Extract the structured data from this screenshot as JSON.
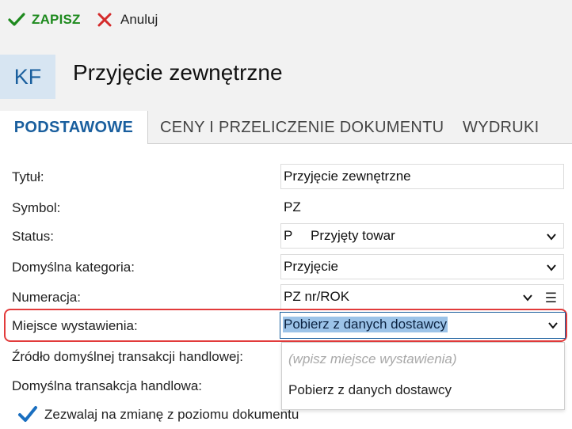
{
  "toolbar": {
    "save_label": "ZAPISZ",
    "cancel_label": "Anuluj"
  },
  "header": {
    "badge": "KF",
    "title": "Przyjęcie zewnętrzne"
  },
  "tabs": [
    {
      "label": "PODSTAWOWE",
      "active": true
    },
    {
      "label": "CENY I PRZELICZENIE DOKUMENTU",
      "active": false
    },
    {
      "label": "WYDRUKI",
      "active": false
    }
  ],
  "form": {
    "tytul": {
      "label": "Tytuł:",
      "value": "Przyjęcie zewnętrzne"
    },
    "symbol": {
      "label": "Symbol:",
      "value": "PZ"
    },
    "status": {
      "label": "Status:",
      "code": "P",
      "value": "Przyjęty towar"
    },
    "kategoria": {
      "label": "Domyślna kategoria:",
      "value": "Przyjęcie"
    },
    "numeracja": {
      "label": "Numeracja:",
      "value": "PZ nr/ROK"
    },
    "miejsce": {
      "label": "Miejsce wystawienia:",
      "value": "Pobierz z danych dostawcy"
    },
    "zrodlo": {
      "label": "Źródło domyślnej transakcji handlowej:"
    },
    "transakcja": {
      "label": "Domyślna transakcja handlowa:"
    }
  },
  "dropdown": {
    "placeholder": "(wpisz miejsce wystawienia)",
    "options": [
      "Pobierz z danych dostawcy"
    ]
  },
  "checkbox": {
    "label": "Zezwalaj na zmianę z poziomu dokumentu",
    "checked": true
  },
  "colors": {
    "accent": "#1a5f9e",
    "save": "#1e8a1e",
    "cancel": "#d42b2b",
    "highlight_border": "#e23b3b",
    "selection": "#9cc3e8"
  }
}
